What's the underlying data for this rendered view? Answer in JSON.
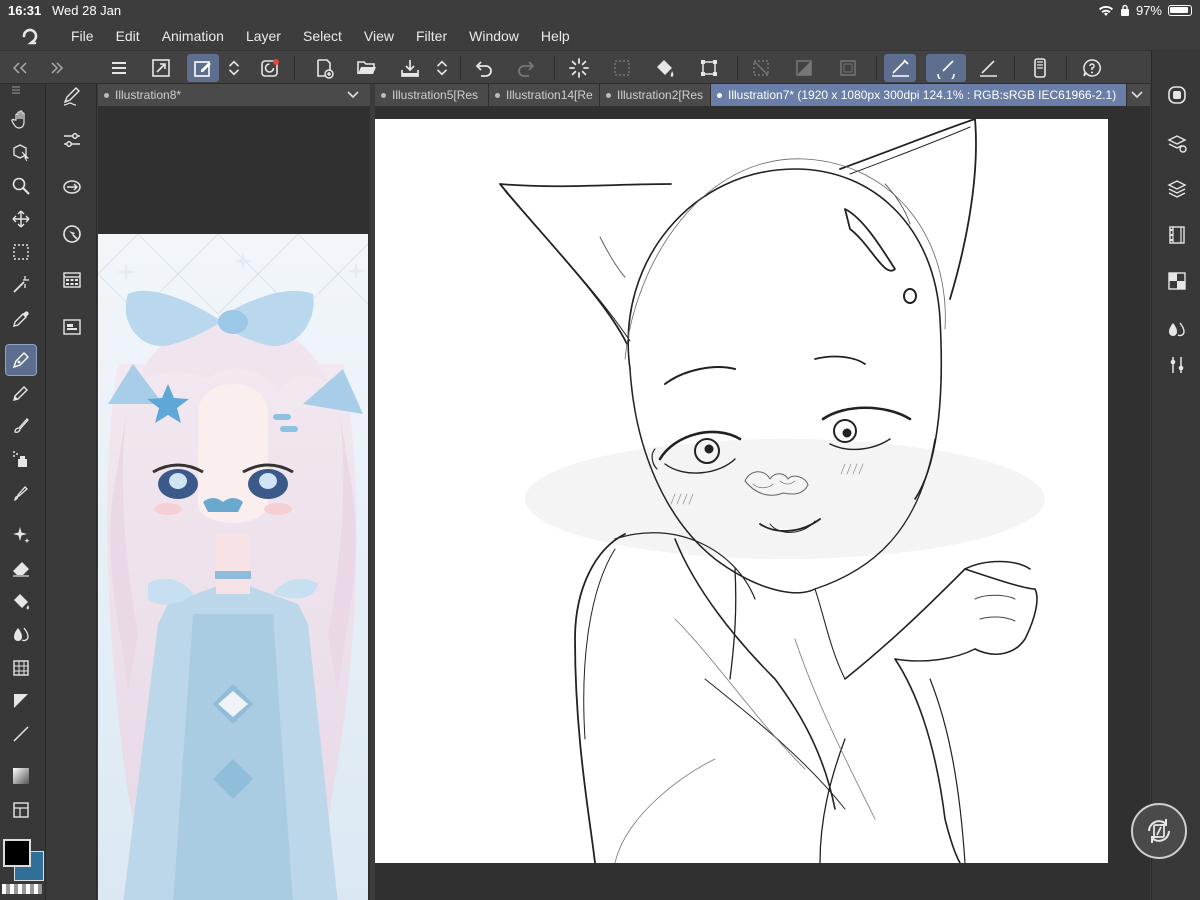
{
  "status": {
    "time": "16:31",
    "date": "Wed 28 Jan",
    "battery": "97%"
  },
  "menu": {
    "items": [
      "File",
      "Edit",
      "Animation",
      "Layer",
      "Select",
      "View",
      "Filter",
      "Window",
      "Help"
    ]
  },
  "tabs_left": [
    {
      "label": "Illustration8*"
    }
  ],
  "tabs_right": [
    {
      "label": "Illustration5[Res"
    },
    {
      "label": "Illustration14[Re"
    },
    {
      "label": "Illustration2[Res"
    },
    {
      "label": "Illustration7* (1920 x 1080px 300dpi 124.1% : RGB:sRGB IEC61966-2.1)"
    }
  ],
  "colors": {
    "main": "#000000",
    "sub": "#2f6f9a",
    "accent": "#5d6e8e"
  }
}
